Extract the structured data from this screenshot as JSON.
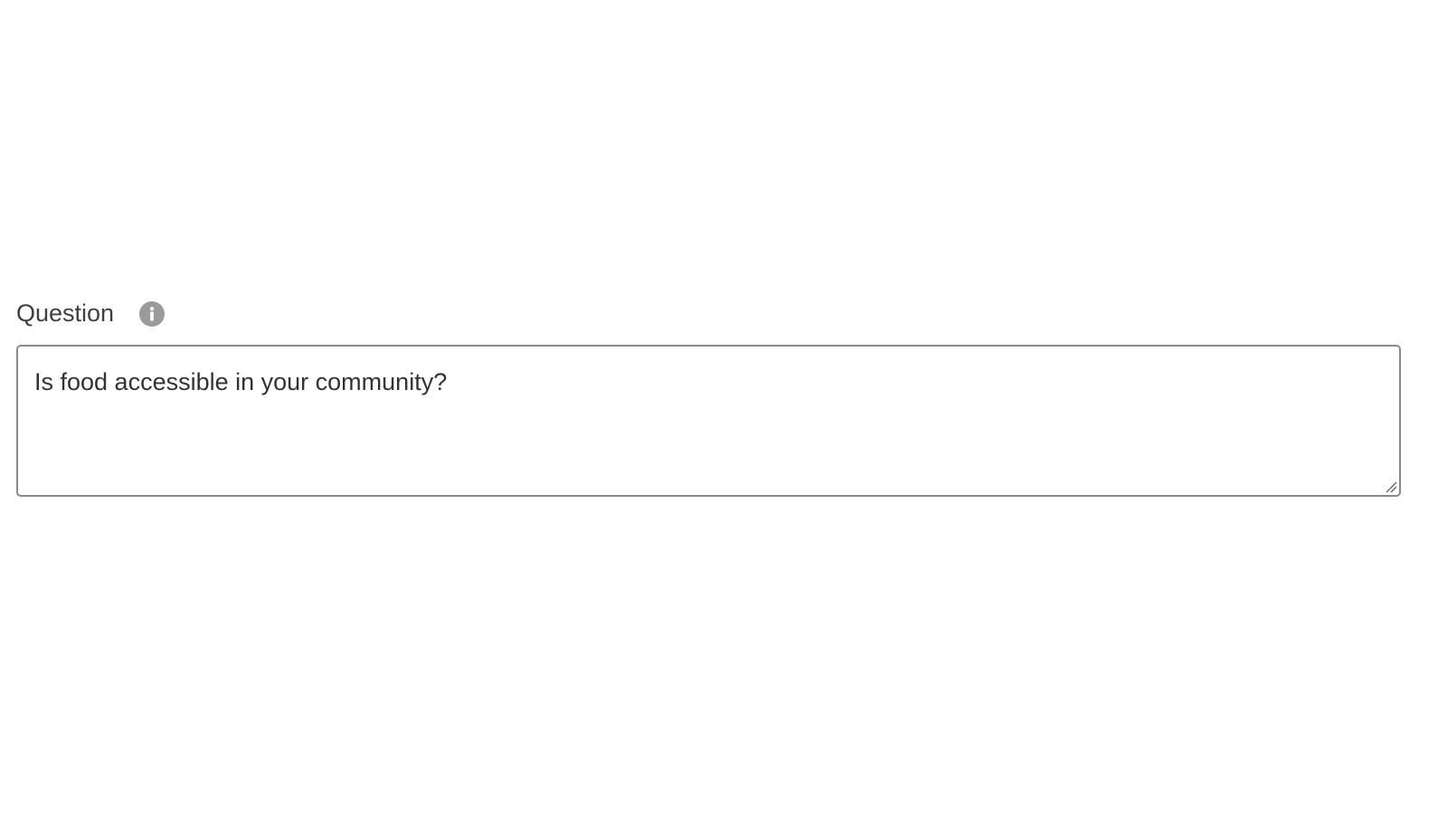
{
  "question_field": {
    "label": "Question",
    "info_icon": "info-icon",
    "value": "Is food accessible in your community?"
  },
  "colors": {
    "label_text": "#3f3f3f",
    "input_text": "#333333",
    "input_border": "#8a8a8a",
    "info_icon_bg": "#9a9a9a"
  }
}
